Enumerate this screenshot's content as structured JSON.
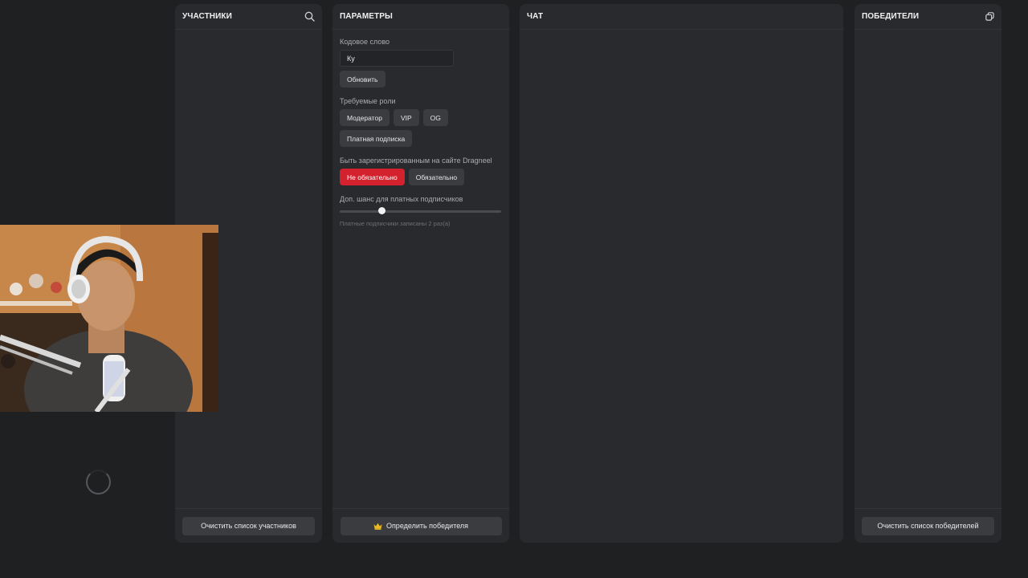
{
  "participants": {
    "title": "УЧАСТНИКИ",
    "search_icon": "search-icon",
    "clear_label": "Очистить список участников"
  },
  "params": {
    "title": "ПАРАМЕТРЫ",
    "codeword": {
      "label": "Кодовое слово",
      "value": "Ку",
      "update_label": "Обновить"
    },
    "roles": {
      "label": "Требуемые роли",
      "items": [
        "Модератор",
        "VIP",
        "OG",
        "Платная подписка"
      ]
    },
    "registration": {
      "label": "Быть зарегистрированным на сайте Dragneel",
      "options": [
        "Не обязательно",
        "Обязательно"
      ],
      "selected": "Не обязательно",
      "accent": "#d3222e"
    },
    "bonus": {
      "label": "Доп. шанс для платных подписчиков",
      "slider_fraction": 0.26,
      "hint": "Платные подписчики записаны 2 раз(а)"
    },
    "determine_label": "Определить победителя",
    "crown_icon": "crown-icon"
  },
  "chat": {
    "title": "ЧАТ"
  },
  "winners": {
    "title": "ПОБЕДИТЕЛИ",
    "copy_icon": "copy-icon",
    "clear_label": "Очистить список победителей"
  }
}
